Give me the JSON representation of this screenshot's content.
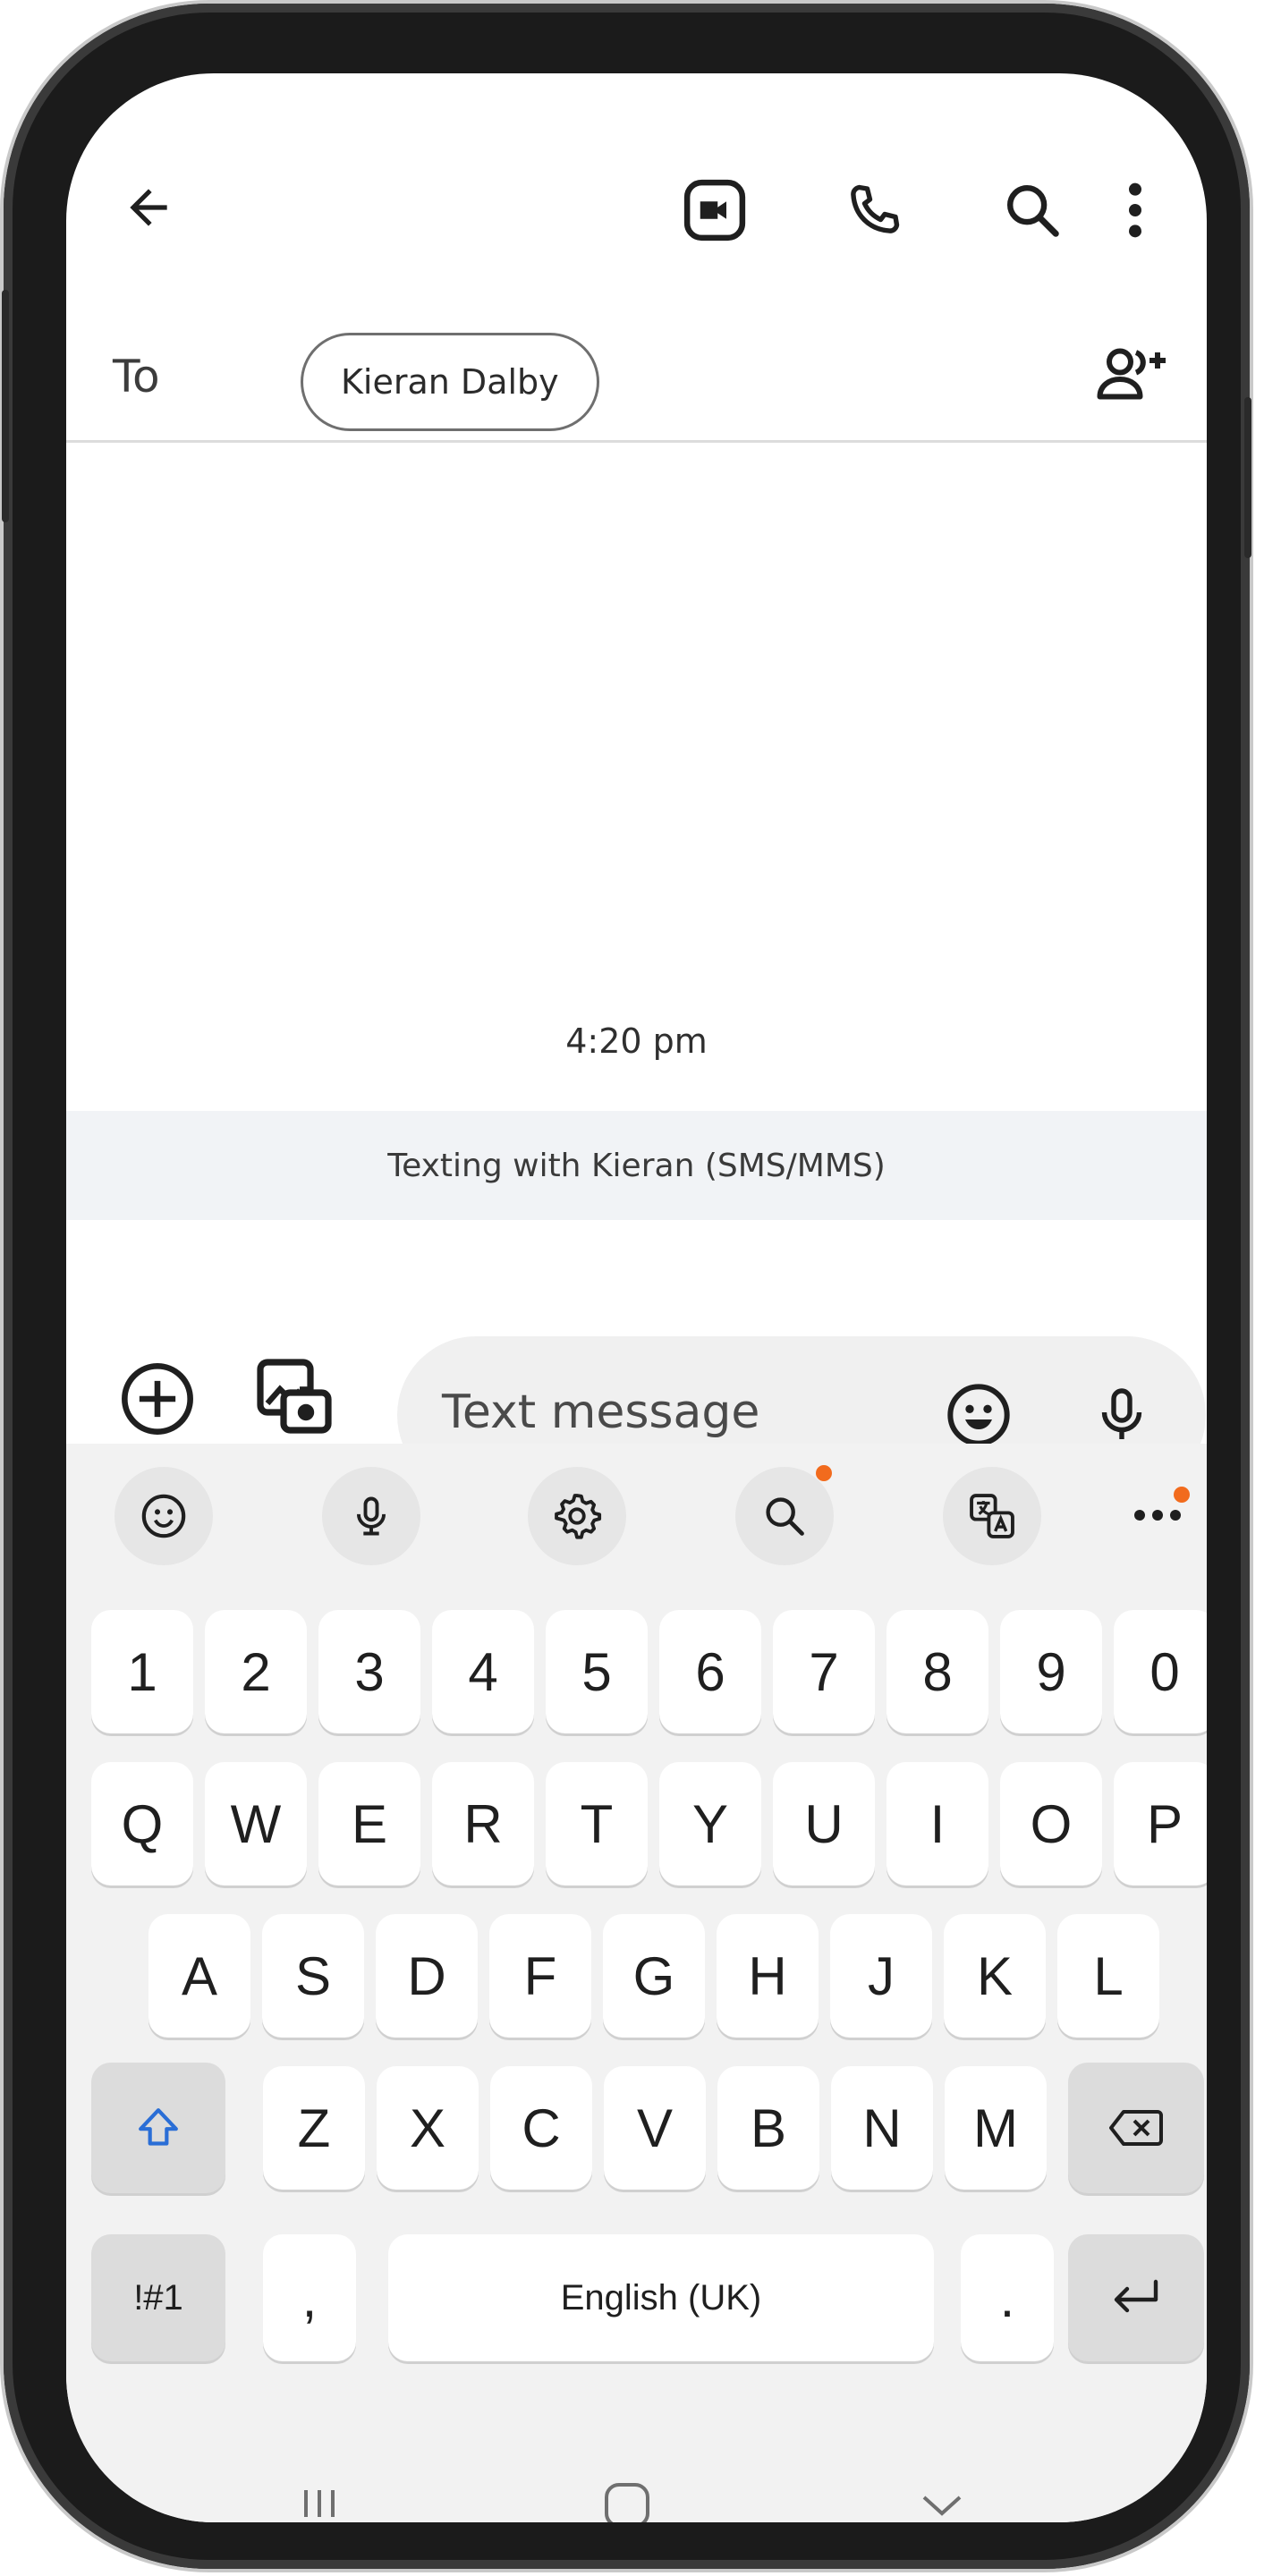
{
  "header": {
    "back_icon": "arrow-left-icon",
    "video_icon": "video-call-icon",
    "phone_icon": "phone-icon",
    "search_icon": "search-icon",
    "more_icon": "more-vert-icon"
  },
  "recipient": {
    "to_label": "To",
    "chip_name": "Kieran Dalby",
    "add_icon": "add-people-icon"
  },
  "conversation": {
    "time": "4:20 pm",
    "banner": "Texting with Kieran (SMS/MMS)"
  },
  "compose": {
    "placeholder": "Text message",
    "add_icon": "add-circle-icon",
    "gallery_icon": "gallery-icon",
    "emoji_icon": "emoji-icon",
    "mic_icon": "mic-icon"
  },
  "keyboard": {
    "toolbar": [
      "emoji",
      "mic",
      "settings",
      "search",
      "translate",
      "more"
    ],
    "number_row": [
      "1",
      "2",
      "3",
      "4",
      "5",
      "6",
      "7",
      "8",
      "9",
      "0"
    ],
    "row1": [
      "Q",
      "W",
      "E",
      "R",
      "T",
      "Y",
      "U",
      "I",
      "O",
      "P"
    ],
    "row2": [
      "A",
      "S",
      "D",
      "F",
      "G",
      "H",
      "J",
      "K",
      "L"
    ],
    "row3": [
      "Z",
      "X",
      "C",
      "V",
      "B",
      "N",
      "M"
    ],
    "symbols_label": "!#1",
    "comma_label": ",",
    "space_label": "English (UK)",
    "period_label": ".",
    "accent_color": "#f26b1d"
  }
}
